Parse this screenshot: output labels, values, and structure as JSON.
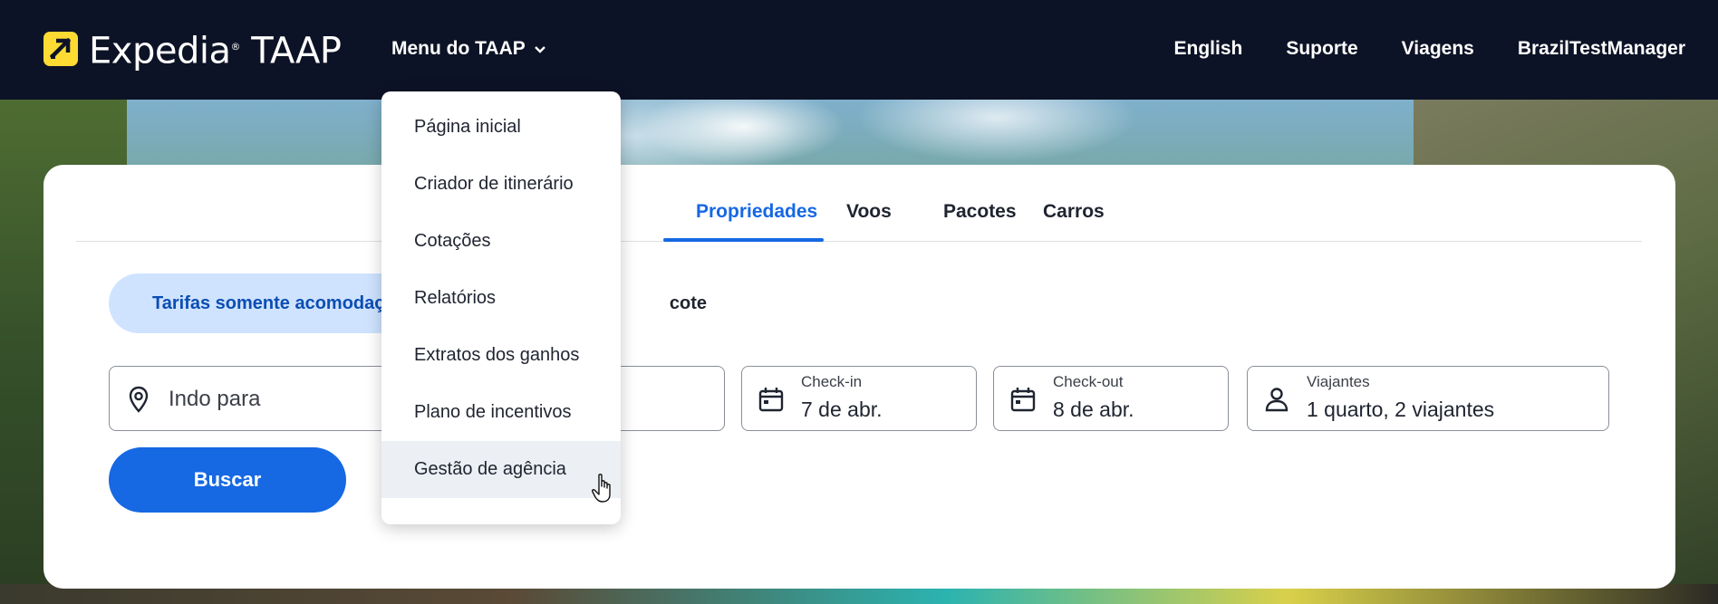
{
  "header": {
    "brand": "Expedia",
    "brand_suffix": "TAAP",
    "menu_trigger": "Menu do TAAP",
    "nav": {
      "language": "English",
      "support": "Suporte",
      "trips": "Viagens",
      "account": "BrazilTestManager"
    }
  },
  "menu": {
    "items": [
      {
        "label": "Página inicial"
      },
      {
        "label": "Criador de itinerário"
      },
      {
        "label": "Cotações"
      },
      {
        "label": "Relatórios"
      },
      {
        "label": "Extratos dos ganhos"
      },
      {
        "label": "Plano de incentivos"
      },
      {
        "label": "Gestão de agência"
      }
    ],
    "hovered_index": 6
  },
  "search": {
    "tabs": [
      {
        "label": "Propriedades",
        "active": true
      },
      {
        "label": "Voos"
      },
      {
        "label": "Pacotes"
      },
      {
        "label": "Carros"
      }
    ],
    "rate_toggle": {
      "active": "Tarifas somente acomodação",
      "other_visible": "cote"
    },
    "destination": {
      "placeholder": "Indo para"
    },
    "checkin": {
      "label": "Check-in",
      "value": "7 de abr."
    },
    "checkout": {
      "label": "Check-out",
      "value": "8 de abr."
    },
    "travelers": {
      "label": "Viajantes",
      "value": "1 quarto, 2 viajantes"
    },
    "search_button": "Buscar"
  },
  "colors": {
    "header_bg": "#0d1326",
    "accent_blue": "#1668e3",
    "pill_bg": "#cfe3ff",
    "logo_yellow": "#fddb32"
  }
}
